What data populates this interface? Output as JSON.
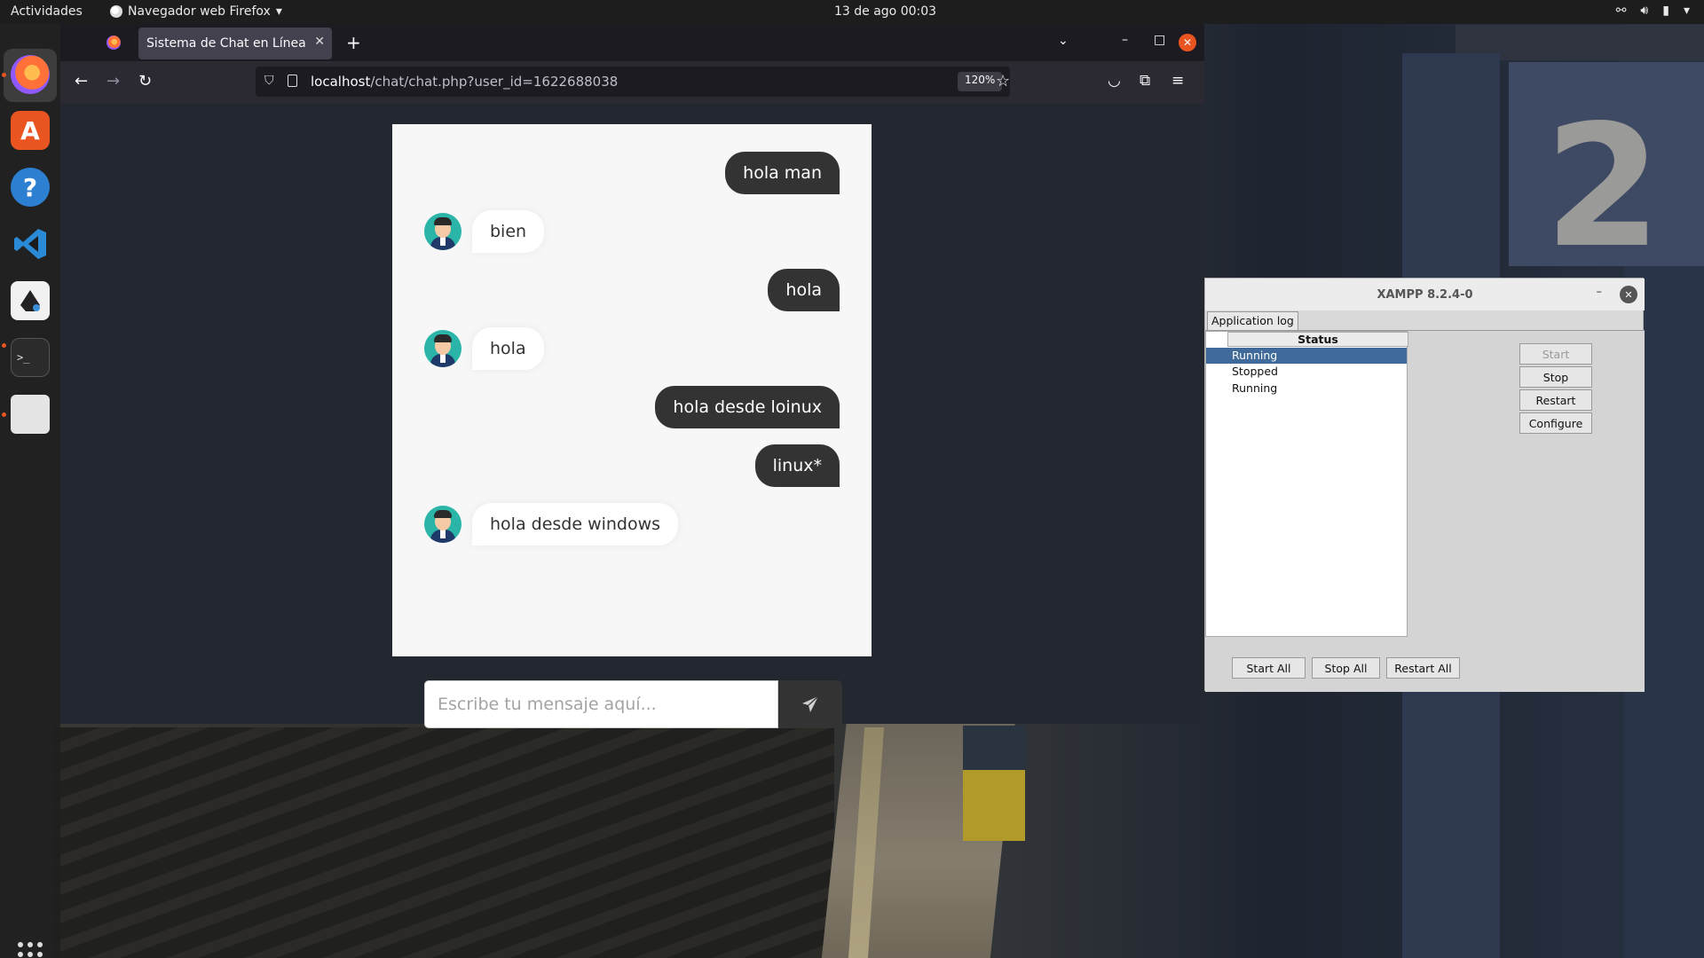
{
  "topbar": {
    "activities": "Actividades",
    "app_name": "Navegador web Firefox",
    "clock": "13 de ago  00:03"
  },
  "dock": {
    "items": [
      "firefox-icon",
      "app-store-icon",
      "help-icon",
      "vscode-icon",
      "inkscape-icon",
      "terminal-icon",
      "files-icon",
      "show-apps-icon"
    ]
  },
  "browser": {
    "tab_title": "Sistema de Chat en Línea en",
    "url_host": "localhost",
    "url_path": "/chat/chat.php?user_id=1622688038",
    "zoom": "120%"
  },
  "chat": {
    "messages": [
      {
        "direction": "outgoing",
        "text": "hola man"
      },
      {
        "direction": "incoming",
        "text": "bien"
      },
      {
        "direction": "outgoing",
        "text": "hola"
      },
      {
        "direction": "incoming",
        "text": "hola"
      },
      {
        "direction": "outgoing",
        "text": "hola desde loinux"
      },
      {
        "direction": "outgoing",
        "text": "linux*"
      },
      {
        "direction": "incoming",
        "text": "hola desde windows"
      }
    ],
    "input_placeholder": "Escribe tu mensaje aquí..."
  },
  "xampp": {
    "title": "XAMPP 8.2.4-0",
    "tab_label": "Application log",
    "status_header": "Status",
    "services": [
      {
        "status": "Running",
        "selected": true
      },
      {
        "status": "Stopped",
        "selected": false
      },
      {
        "status": "Running",
        "selected": false
      }
    ],
    "buttons": {
      "start": "Start",
      "stop": "Stop",
      "restart": "Restart",
      "configure": "Configure",
      "start_all": "Start All",
      "stop_all": "Stop All",
      "restart_all": "Restart All"
    }
  },
  "colors": {
    "accent": "#e95420",
    "chat_outgoing_bg": "#333333",
    "chat_incoming_bg": "#ffffff",
    "xampp_selection": "#3f6a9a"
  }
}
